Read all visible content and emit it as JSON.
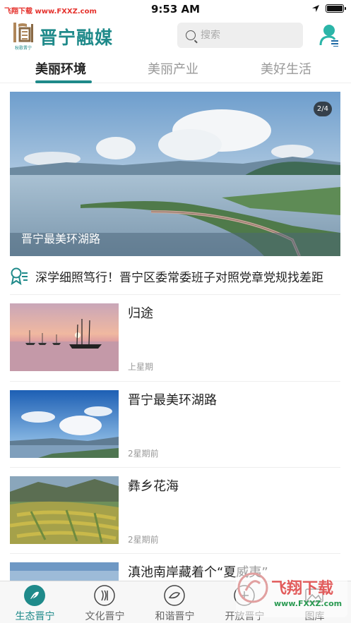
{
  "status_bar": {
    "watermark_text": "飞翔下载 www.FXXZ.com",
    "time": "9:53 AM",
    "battery_level": 1.0
  },
  "header": {
    "logo_sub": "秋歌晋宁",
    "title": "晋宁融媒",
    "search_placeholder": "搜索",
    "accent_color": "#1f8a8a",
    "icons": [
      "logo-icon",
      "search-icon",
      "user-icon"
    ]
  },
  "tabs": [
    {
      "label": "美丽环境",
      "active": true
    },
    {
      "label": "美丽产业",
      "active": false
    },
    {
      "label": "美好生活",
      "active": false
    }
  ],
  "hero": {
    "caption": "晋宁最美环湖路",
    "badge": "2/4"
  },
  "headline": {
    "icon": "award-icon",
    "text": "深学细照笃行！晋宁区委常委班子对照党章党规找差距"
  },
  "news": [
    {
      "title": "归途",
      "time": "上星期",
      "image": "sunset-boats"
    },
    {
      "title": "晋宁最美环湖路",
      "time": "2星期前",
      "image": "lake-clouds"
    },
    {
      "title": "彝乡花海",
      "time": "2星期前",
      "image": "terraced-fields"
    },
    {
      "title": "滇池南岸藏着个“夏威夷”",
      "time": "",
      "image": "lake-sky"
    }
  ],
  "bottom_nav": [
    {
      "label": "生态晋宁",
      "icon": "ecology-icon",
      "active": true
    },
    {
      "label": "文化晋宁",
      "icon": "culture-icon",
      "active": false
    },
    {
      "label": "和谐晋宁",
      "icon": "harmony-icon",
      "active": false
    },
    {
      "label": "开放晋宁",
      "icon": "open-icon",
      "active": false
    },
    {
      "label": "图库",
      "icon": "gallery-icon",
      "active": false
    }
  ],
  "overlay_watermark": {
    "brand": "飞翔下载",
    "url": "www.FXXZ.com"
  }
}
